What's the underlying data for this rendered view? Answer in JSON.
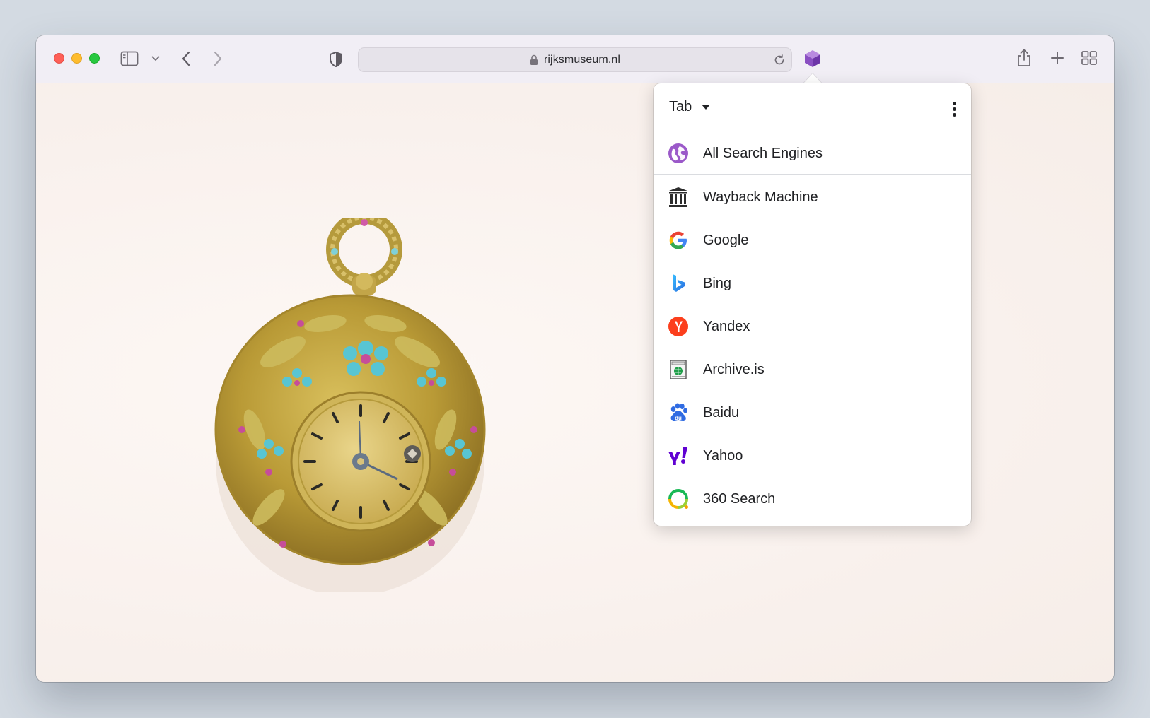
{
  "browser": {
    "url": "rijksmuseum.nl",
    "icons": {
      "sidebar": "sidebar-icon",
      "back": "chevron-left-icon",
      "forward": "chevron-right-icon",
      "privacy": "shield-icon",
      "extension": "cube-icon",
      "share": "share-icon",
      "new_tab": "plus-icon",
      "tab_overview": "grid-icon"
    }
  },
  "popup": {
    "mode_label": "Tab",
    "all_engines": "All Search Engines",
    "engines": [
      {
        "label": "Wayback Machine",
        "icon": "institution-icon"
      },
      {
        "label": "Google",
        "icon": "google-icon"
      },
      {
        "label": "Bing",
        "icon": "bing-icon"
      },
      {
        "label": "Yandex",
        "icon": "yandex-icon"
      },
      {
        "label": "Archive.is",
        "icon": "archive-is-icon"
      },
      {
        "label": "Baidu",
        "icon": "baidu-icon"
      },
      {
        "label": "Yahoo",
        "icon": "yahoo-icon"
      },
      {
        "label": "360 Search",
        "icon": "360-search-icon"
      }
    ]
  },
  "colors": {
    "accent_purple": "#9b59c9",
    "close": "#fe5f57",
    "minimize": "#febc2e",
    "zoom": "#28c840"
  }
}
